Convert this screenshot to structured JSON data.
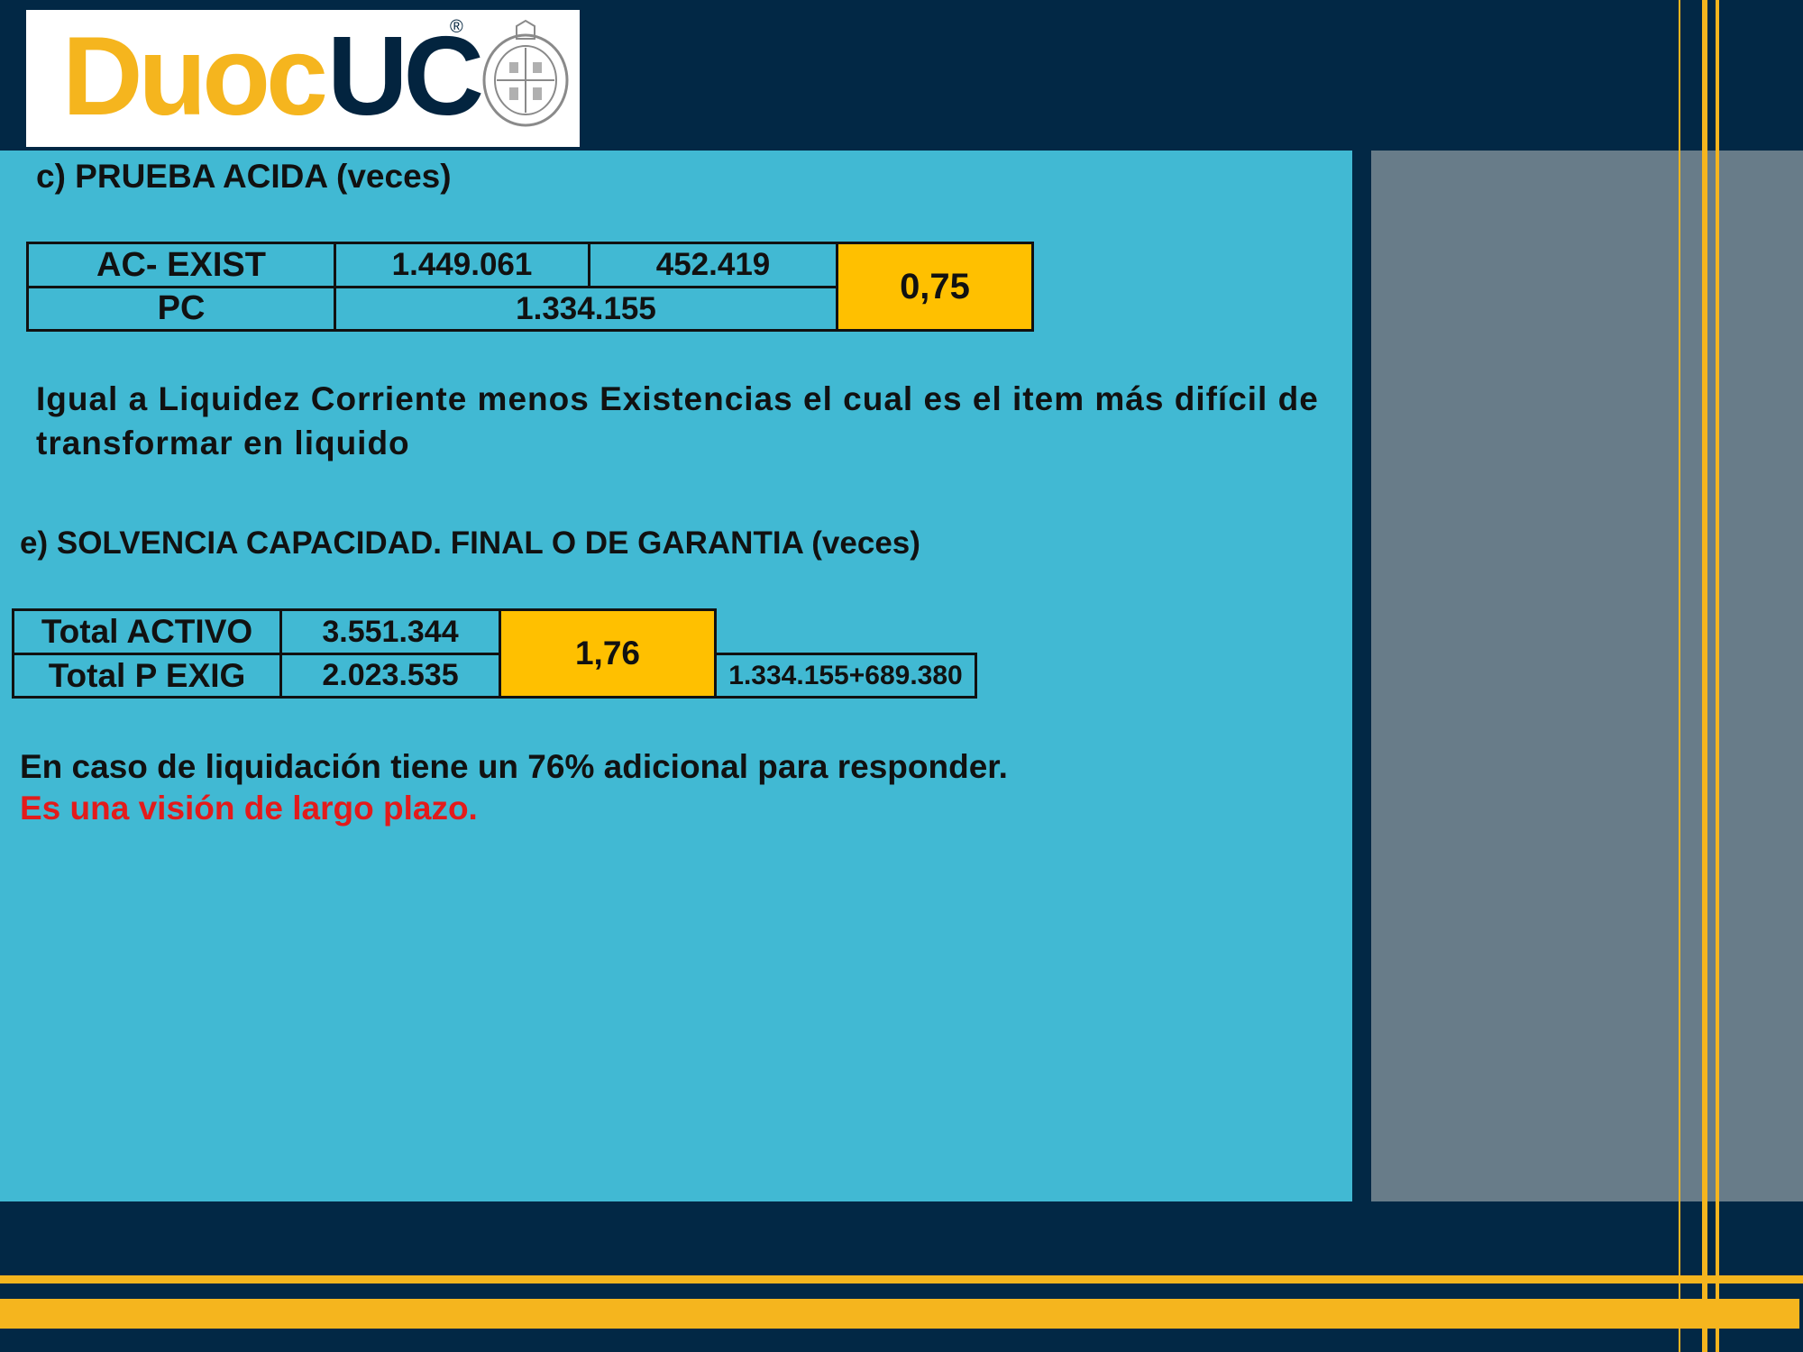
{
  "logo": {
    "name_part1": "Duoc",
    "name_part2": "UC",
    "registered_mark": "®"
  },
  "acid_test": {
    "heading": "c) PRUEBA ACIDA (veces)",
    "table": {
      "row1_label": "AC- EXIST",
      "row1_value1": "1.449.061",
      "row1_value2": "452.419",
      "row2_label": "PC",
      "row2_value": "1.334.155",
      "result": "0,75"
    },
    "explanation": "Igual a Liquidez Corriente menos Existencias el cual es el item más difícil de transformar en liquido"
  },
  "solvency": {
    "heading": "e) SOLVENCIA CAPACIDAD. FINAL O DE GARANTIA (veces)",
    "table": {
      "row1_label": "Total ACTIVO",
      "row1_value": "3.551.344",
      "row2_label": "Total P EXIG",
      "row2_value": "2.023.535",
      "result": "1,76",
      "breakdown": "1.334.155+689.380"
    },
    "explanation": "En caso de liquidación tiene un 76% adicional para responder.",
    "highlight": "Es una visión de largo plazo."
  },
  "colors": {
    "navy": "#022845",
    "cyan_panel": "#41B9D3",
    "gray_panel": "#687C89",
    "gold_accent": "#F5B51E",
    "result_yellow": "#FFC000",
    "highlight_red": "#E31B1B"
  }
}
